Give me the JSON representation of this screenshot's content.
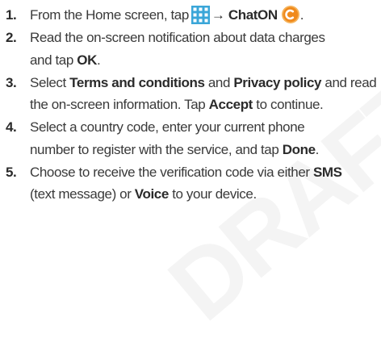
{
  "steps": [
    {
      "number": "1.",
      "parts": {
        "a": "From the Home screen, tap",
        "arrow": "→",
        "app": "ChatON",
        "end": "."
      },
      "icons": [
        "apps-grid-icon",
        "chaton-icon"
      ]
    },
    {
      "number": "2.",
      "line1": "Read the on-screen notification about data charges",
      "line2a": "and tap ",
      "ok": "OK",
      "line2b": "."
    },
    {
      "number": "3.",
      "a": "Select ",
      "terms": "Terms and conditions",
      "b": " and ",
      "privacy": "Privacy policy",
      "c": " and read",
      "line2a": "the on-screen information. Tap ",
      "accept": "Accept",
      "line2b": " to continue."
    },
    {
      "number": "4.",
      "line1": "Select a country code, enter your current phone",
      "line2a": "number to register with the service, and tap ",
      "done": "Done",
      "line2b": "."
    },
    {
      "number": "5.",
      "a": "Choose to receive the verification code via either ",
      "sms": "SMS",
      "line2a": "(text message) or ",
      "voice": "Voice",
      "line2b": " to your device."
    }
  ],
  "colors": {
    "grid_icon": "#3aa6d8",
    "chaton_orange": "#f08a1c",
    "text": "#3a3a3a"
  }
}
